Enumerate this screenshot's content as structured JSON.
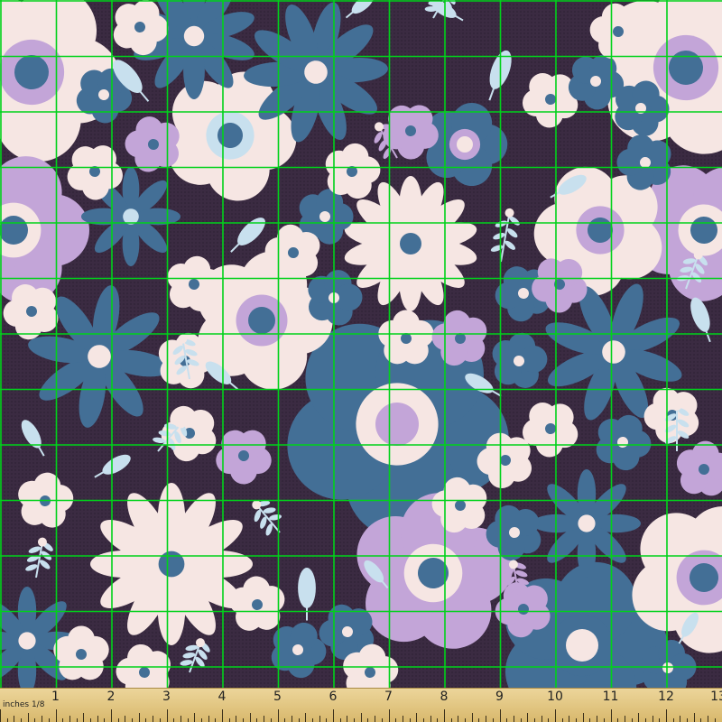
{
  "image": {
    "subject": "purple floral fabric swatch with green measuring grid and wooden ruler",
    "colors": {
      "background": "#3b2b42",
      "blue": "#436f96",
      "cream": "#f6e6e3",
      "lavender": "#c3a5d8",
      "light_blue": "#c8e0ee",
      "grid": "#00d21a",
      "ruler": "#e3c683"
    }
  },
  "ruler": {
    "unit_label": "inches 1/8",
    "numbers": [
      "1",
      "2",
      "3",
      "4",
      "5",
      "6",
      "7",
      "8",
      "9",
      "10",
      "11",
      "12",
      "13"
    ]
  }
}
